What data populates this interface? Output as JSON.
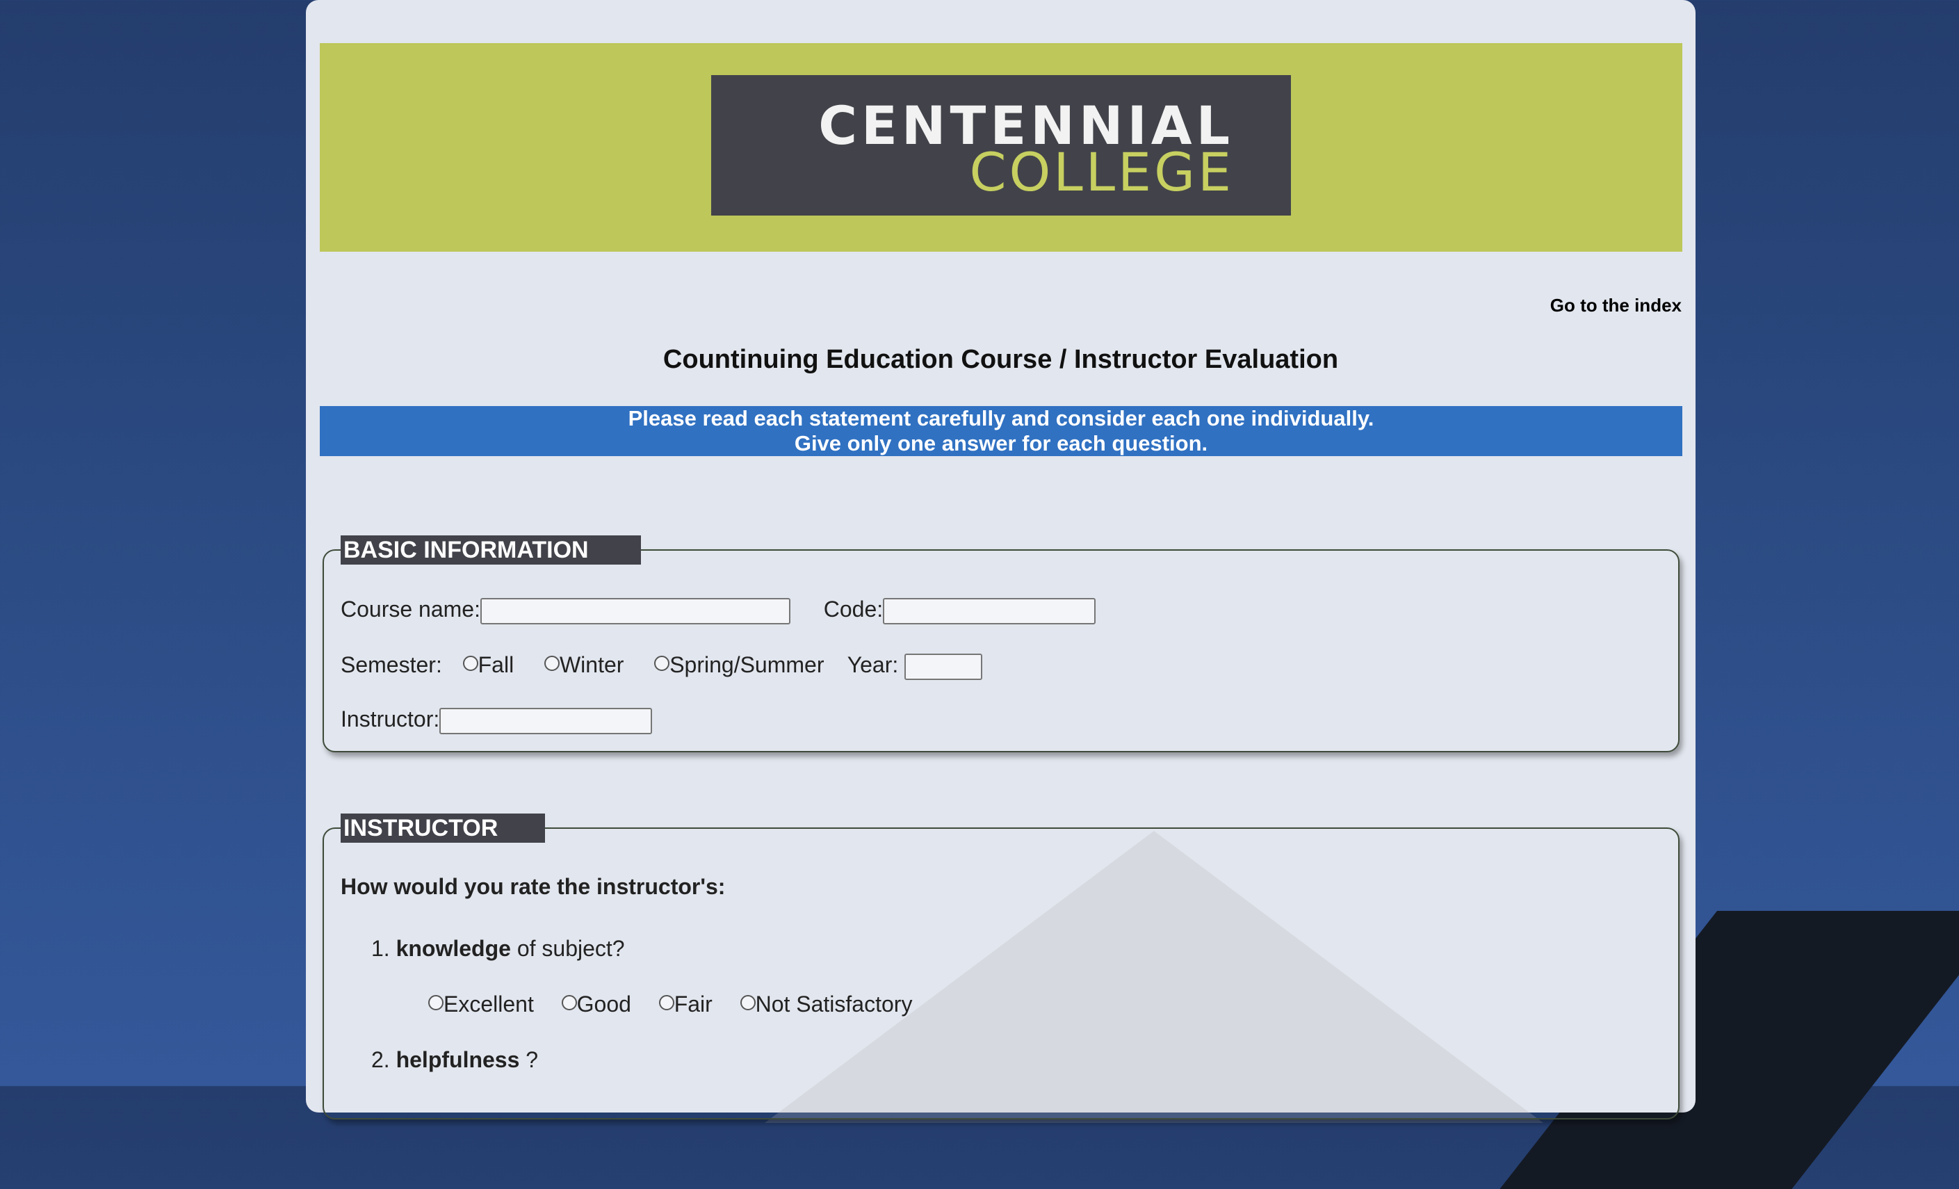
{
  "logo": {
    "line1": "CENTENNIAL",
    "line2": "COLLEGE"
  },
  "nav": {
    "index_link": "Go to the index"
  },
  "title": "Countinuing Education Course / Instructor Evaluation",
  "notice": {
    "line1": "Please read each statement carefully and consider each one individually.",
    "line2": "Give only one answer for each question."
  },
  "basic": {
    "legend": "BASIC INFORMATION",
    "course_name_label": "Course name:",
    "code_label": "Code:",
    "semester_label": "Semester:",
    "semesters": [
      "Fall",
      "Winter",
      "Spring/Summer"
    ],
    "year_label": "Year:",
    "instructor_label": "Instructor:"
  },
  "instructor": {
    "legend": "INSTRUCTOR",
    "prompt": "How would you rate the instructor's:",
    "q1": {
      "num": "1.",
      "bold": "knowledge",
      "rest": " of subject?"
    },
    "q2": {
      "num": "2.",
      "bold": "helpfulness",
      "rest": " ?"
    },
    "ratings": [
      "Excellent",
      "Good",
      "Fair",
      "Not Satisfactory"
    ]
  }
}
